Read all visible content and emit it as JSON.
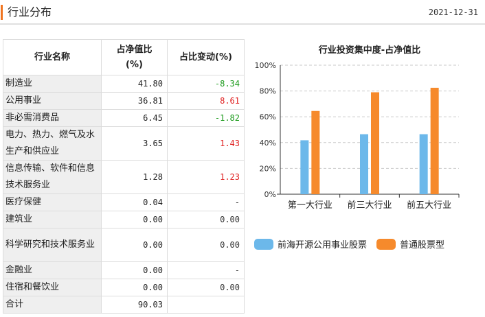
{
  "header": {
    "title": "行业分布",
    "date": "2021-12-31"
  },
  "table": {
    "columns": [
      "行业名称",
      "占净值比(%)",
      "占比变动(%)"
    ],
    "col_name": "行业名称",
    "col_ratio_line1": "占净值比",
    "col_ratio_line2": "(%)",
    "col_change": "占比变动(%)",
    "rows": [
      {
        "name": "制造业",
        "ratio": "41.80",
        "change": "-8.34",
        "dir": "neg"
      },
      {
        "name": "公用事业",
        "ratio": "36.81",
        "change": "8.61",
        "dir": "pos"
      },
      {
        "name": "非必需消费品",
        "ratio": "6.45",
        "change": "-1.82",
        "dir": "neg"
      },
      {
        "name": "电力、热力、燃气及水生产和供应业",
        "ratio": "3.65",
        "change": "1.43",
        "dir": "pos"
      },
      {
        "name": "信息传输、软件和信息技术服务业",
        "ratio": "1.28",
        "change": "1.23",
        "dir": "pos"
      },
      {
        "name": "医疗保健",
        "ratio": "0.04",
        "change": "-",
        "dir": "neutral"
      },
      {
        "name": "建筑业",
        "ratio": "0.00",
        "change": "0.00",
        "dir": "neutral"
      },
      {
        "name": "科学研究和技术服务业",
        "ratio": "0.00",
        "change": "0.00",
        "dir": "neutral"
      },
      {
        "name": "金融业",
        "ratio": "0.00",
        "change": "-",
        "dir": "neutral"
      },
      {
        "name": "住宿和餐饮业",
        "ratio": "0.00",
        "change": "0.00",
        "dir": "neutral"
      },
      {
        "name": "合计",
        "ratio": "90.03",
        "change": "",
        "dir": "neutral"
      }
    ]
  },
  "chart_data": {
    "type": "bar",
    "title": "行业投资集中度-占净值比",
    "categories": [
      "第一大行业",
      "前三大行业",
      "前五大行业"
    ],
    "series": [
      {
        "name": "前海开源公用事业股票",
        "color": "#6cb8ea",
        "values": [
          41.8,
          46.5,
          46.5
        ]
      },
      {
        "name": "普通股票型",
        "color": "#f68a2c",
        "values": [
          64.5,
          79.0,
          82.5
        ]
      }
    ],
    "ylim": [
      0,
      100
    ],
    "yticks": [
      "0%",
      "20%",
      "40%",
      "60%",
      "80%",
      "100%"
    ],
    "grid": true,
    "legend_position": "bottom"
  },
  "colors": {
    "accent": "#f0741f",
    "positive": "#e02020",
    "negative": "#1a9a1a",
    "label_bg": "#efefef"
  }
}
